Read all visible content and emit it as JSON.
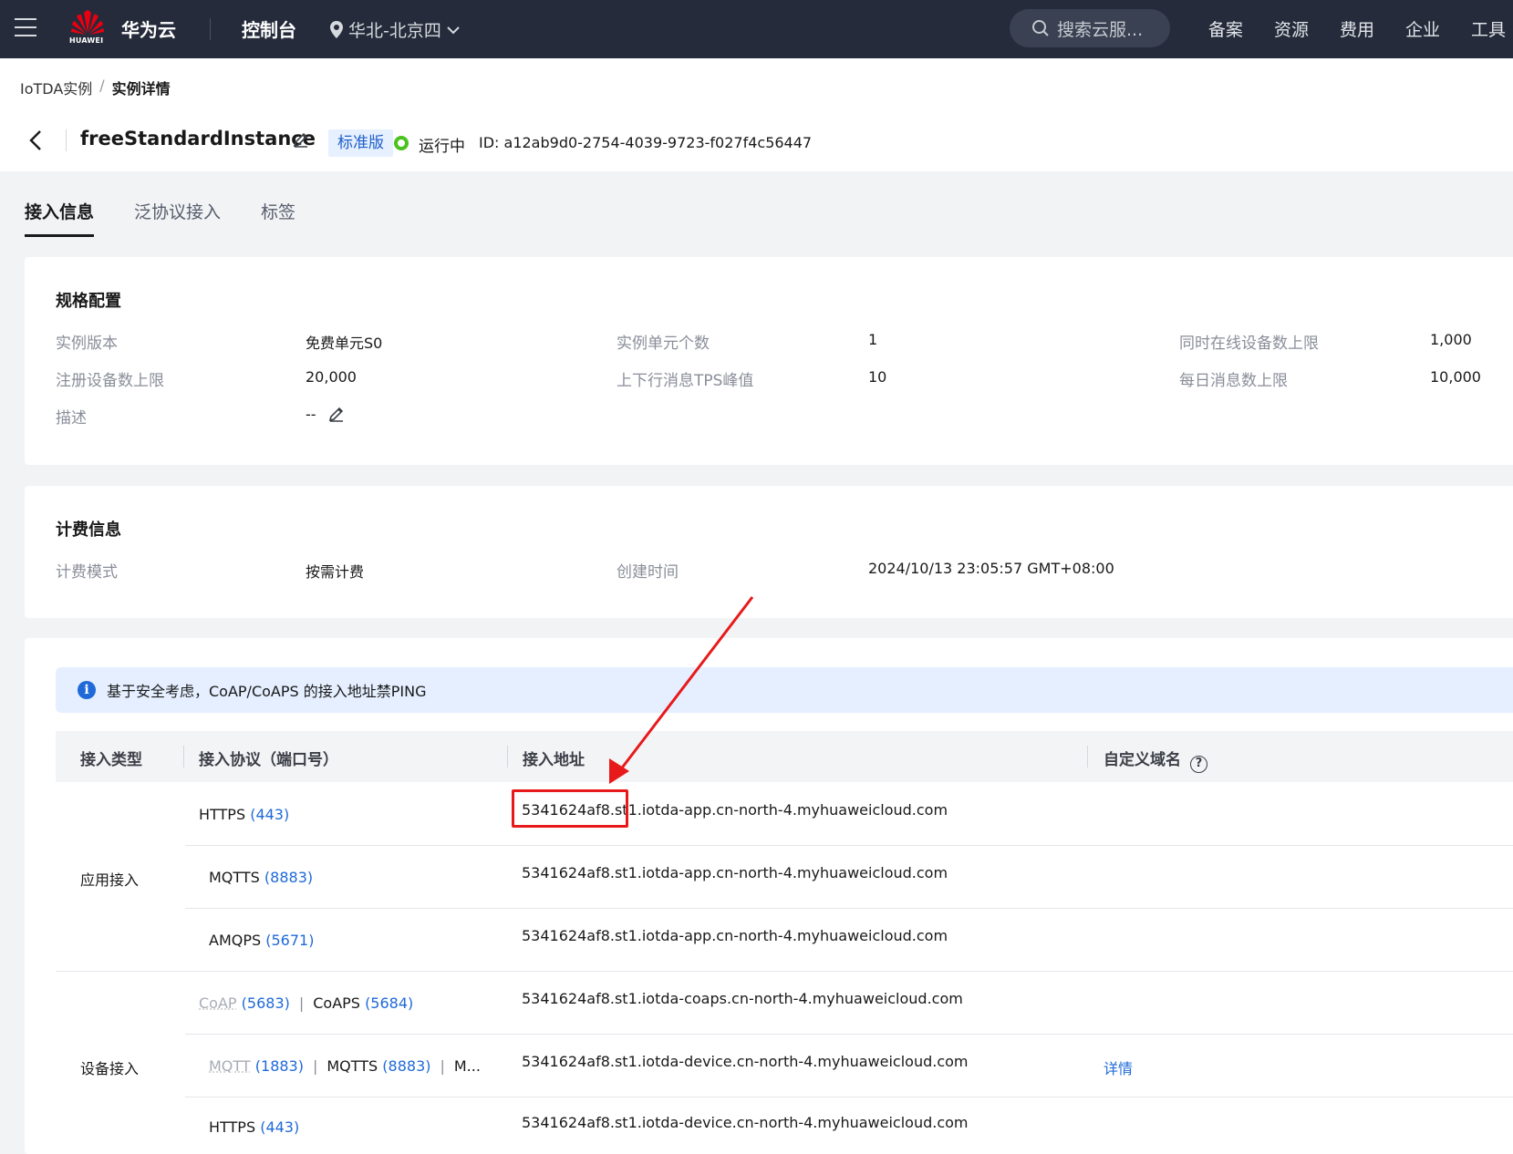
{
  "topnav": {
    "logo_text": "HUAWEI",
    "brand": "华为云",
    "console": "控制台",
    "region": "华北-北京四",
    "search_placeholder": "搜索云服...",
    "links": [
      "备案",
      "资源",
      "费用",
      "企业",
      "工具"
    ]
  },
  "breadcrumb": {
    "parent": "IoTDA实例",
    "separator": "/",
    "current": "实例详情"
  },
  "instance": {
    "name": "freeStandardInstance",
    "edition": "标准版",
    "status": "运行中",
    "id": "ID: a12ab9d0-2754-4039-9723-f027f4c56447"
  },
  "tabs": [
    "接入信息",
    "泛协议接入",
    "标签"
  ],
  "spec": {
    "title": "规格配置",
    "version_label": "实例版本",
    "version_value": "免费单元S0",
    "units_label": "实例单元个数",
    "units_value": "1",
    "online_label": "同时在线设备数上限",
    "online_value": "1,000",
    "register_label": "注册设备数上限",
    "register_value": "20,000",
    "tps_label": "上下行消息TPS峰值",
    "tps_value": "10",
    "daily_label": "每日消息数上限",
    "daily_value": "10,000",
    "desc_label": "描述",
    "desc_value": "--"
  },
  "billing": {
    "title": "计费信息",
    "mode_label": "计费模式",
    "mode_value": "按需计费",
    "created_label": "创建时间",
    "created_value": "2024/10/13 23:05:57 GMT+08:00"
  },
  "notice": "基于安全考虑，CoAP/CoAPS 的接入地址禁PING",
  "table": {
    "headers": [
      "接入类型",
      "接入协议（端口号）",
      "接入地址",
      "自定义域名"
    ],
    "groups": {
      "app": "应用接入",
      "device": "设备接入"
    },
    "rows": [
      {
        "proto": "HTTPS",
        "port": "(443)",
        "address": "5341624af8.st1.iotda-app.cn-north-4.myhuaweicloud.com"
      },
      {
        "proto": "MQTTS",
        "port": "(8883)",
        "address": "5341624af8.st1.iotda-app.cn-north-4.myhuaweicloud.com"
      },
      {
        "proto": "AMQPS",
        "port": "(5671)",
        "address": "5341624af8.st1.iotda-app.cn-north-4.myhuaweicloud.com"
      },
      {
        "proto_disabled": "CoAP",
        "port1": "(5683)",
        "sep": "|",
        "proto2": "CoAPS",
        "port2": "(5684)",
        "address": "5341624af8.st1.iotda-coaps.cn-north-4.myhuaweicloud.com"
      },
      {
        "proto_disabled": "MQTT",
        "port1": "(1883)",
        "sep": "|",
        "proto2": "MQTTS",
        "port2": "(8883)",
        "sep2": "|",
        "more": "M...",
        "address": "5341624af8.st1.iotda-device.cn-north-4.myhuaweicloud.com",
        "custom_domain_link": "详情"
      },
      {
        "proto": "HTTPS",
        "port": "(443)",
        "address": "5341624af8.st1.iotda-device.cn-north-4.myhuaweicloud.com"
      }
    ]
  },
  "colors": {
    "nav_bg": "#252b3a",
    "accent_blue": "#1f6ad8",
    "status_green": "#4bc21e",
    "annotation_red": "#e8191b"
  },
  "icons": [
    "hamburger-icon",
    "huawei-logo",
    "location-pin-icon",
    "chevron-down-icon",
    "search-icon",
    "back-arrow-icon",
    "edit-icon",
    "status-dot-icon",
    "info-icon",
    "help-icon"
  ]
}
